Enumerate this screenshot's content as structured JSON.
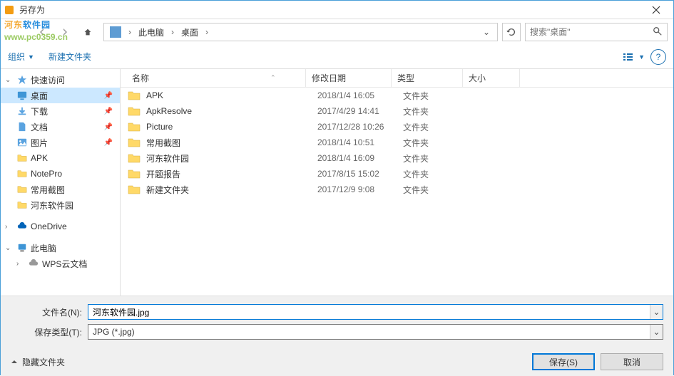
{
  "title": "另存为",
  "watermark": {
    "t1": "河东",
    "t2": "软件园",
    "url": "www.pc0359.cn"
  },
  "breadcrumb": {
    "items": [
      "此电脑",
      "桌面"
    ],
    "sep": "›"
  },
  "search": {
    "placeholder": "搜索\"桌面\""
  },
  "toolbar": {
    "organize": "组织",
    "new_folder": "新建文件夹"
  },
  "sidebar": {
    "quick": "快速访问",
    "desktop": "桌面",
    "downloads": "下载",
    "documents": "文档",
    "pictures": "图片",
    "apk": "APK",
    "notepro": "NotePro",
    "screenshots": "常用截图",
    "hedong": "河东软件园",
    "onedrive": "OneDrive",
    "thispc": "此电脑",
    "wps": "WPS云文档"
  },
  "columns": {
    "name": "名称",
    "date": "修改日期",
    "type": "类型",
    "size": "大小"
  },
  "files": [
    {
      "name": "APK",
      "date": "2018/1/4 16:05",
      "type": "文件夹"
    },
    {
      "name": "ApkResolve",
      "date": "2017/4/29 14:41",
      "type": "文件夹"
    },
    {
      "name": "Picture",
      "date": "2017/12/28 10:26",
      "type": "文件夹"
    },
    {
      "name": "常用截图",
      "date": "2018/1/4 10:51",
      "type": "文件夹"
    },
    {
      "name": "河东软件园",
      "date": "2018/1/4 16:09",
      "type": "文件夹"
    },
    {
      "name": "开题报告",
      "date": "2017/8/15 15:02",
      "type": "文件夹"
    },
    {
      "name": "新建文件夹",
      "date": "2017/12/9 9:08",
      "type": "文件夹"
    }
  ],
  "form": {
    "filename_label": "文件名(N):",
    "filename_value": "河东软件园.jpg",
    "filetype_label": "保存类型(T):",
    "filetype_value": "JPG (*.jpg)"
  },
  "actions": {
    "hide_folders": "隐藏文件夹",
    "save": "保存(S)",
    "cancel": "取消"
  }
}
